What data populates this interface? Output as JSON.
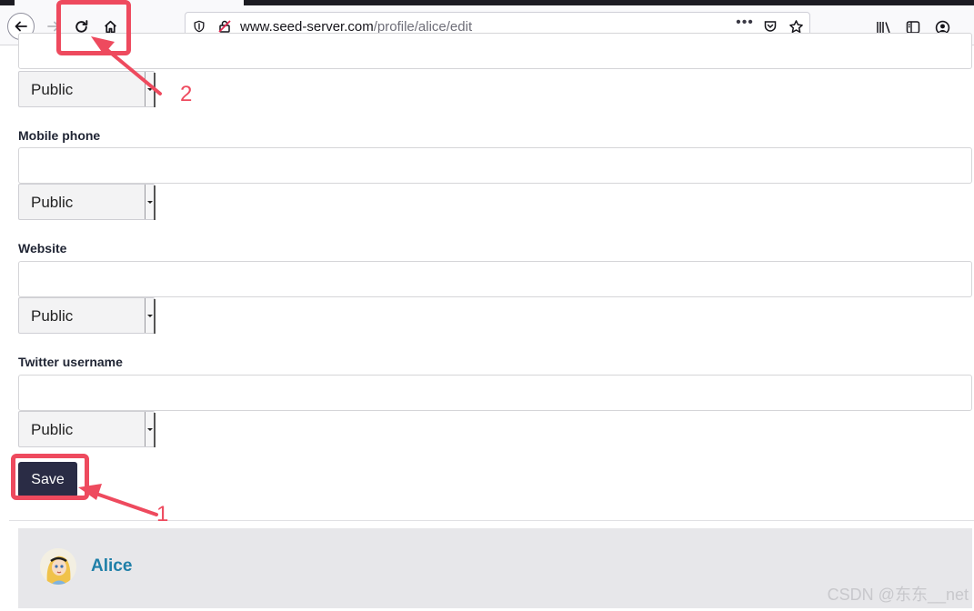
{
  "browser": {
    "url_host": "www.seed-server.com",
    "url_path": "/profile/alice/edit",
    "page_actions": "•••"
  },
  "form": {
    "fields": [
      {
        "label": "",
        "value": "",
        "access": "Public"
      },
      {
        "label": "Mobile phone",
        "value": "",
        "access": "Public"
      },
      {
        "label": "Website",
        "value": "",
        "access": "Public"
      },
      {
        "label": "Twitter username",
        "value": "",
        "access": "Public"
      }
    ],
    "save_label": "Save"
  },
  "owner": {
    "name": "Alice"
  },
  "annotations": {
    "one": "1",
    "two": "2",
    "color": "#ee4a5e"
  },
  "watermark": "CSDN @东东__net",
  "colors": {
    "save_button": "#2a2c45",
    "owner_link": "#1f7fa8",
    "owner_block": "#e7e7ea"
  }
}
